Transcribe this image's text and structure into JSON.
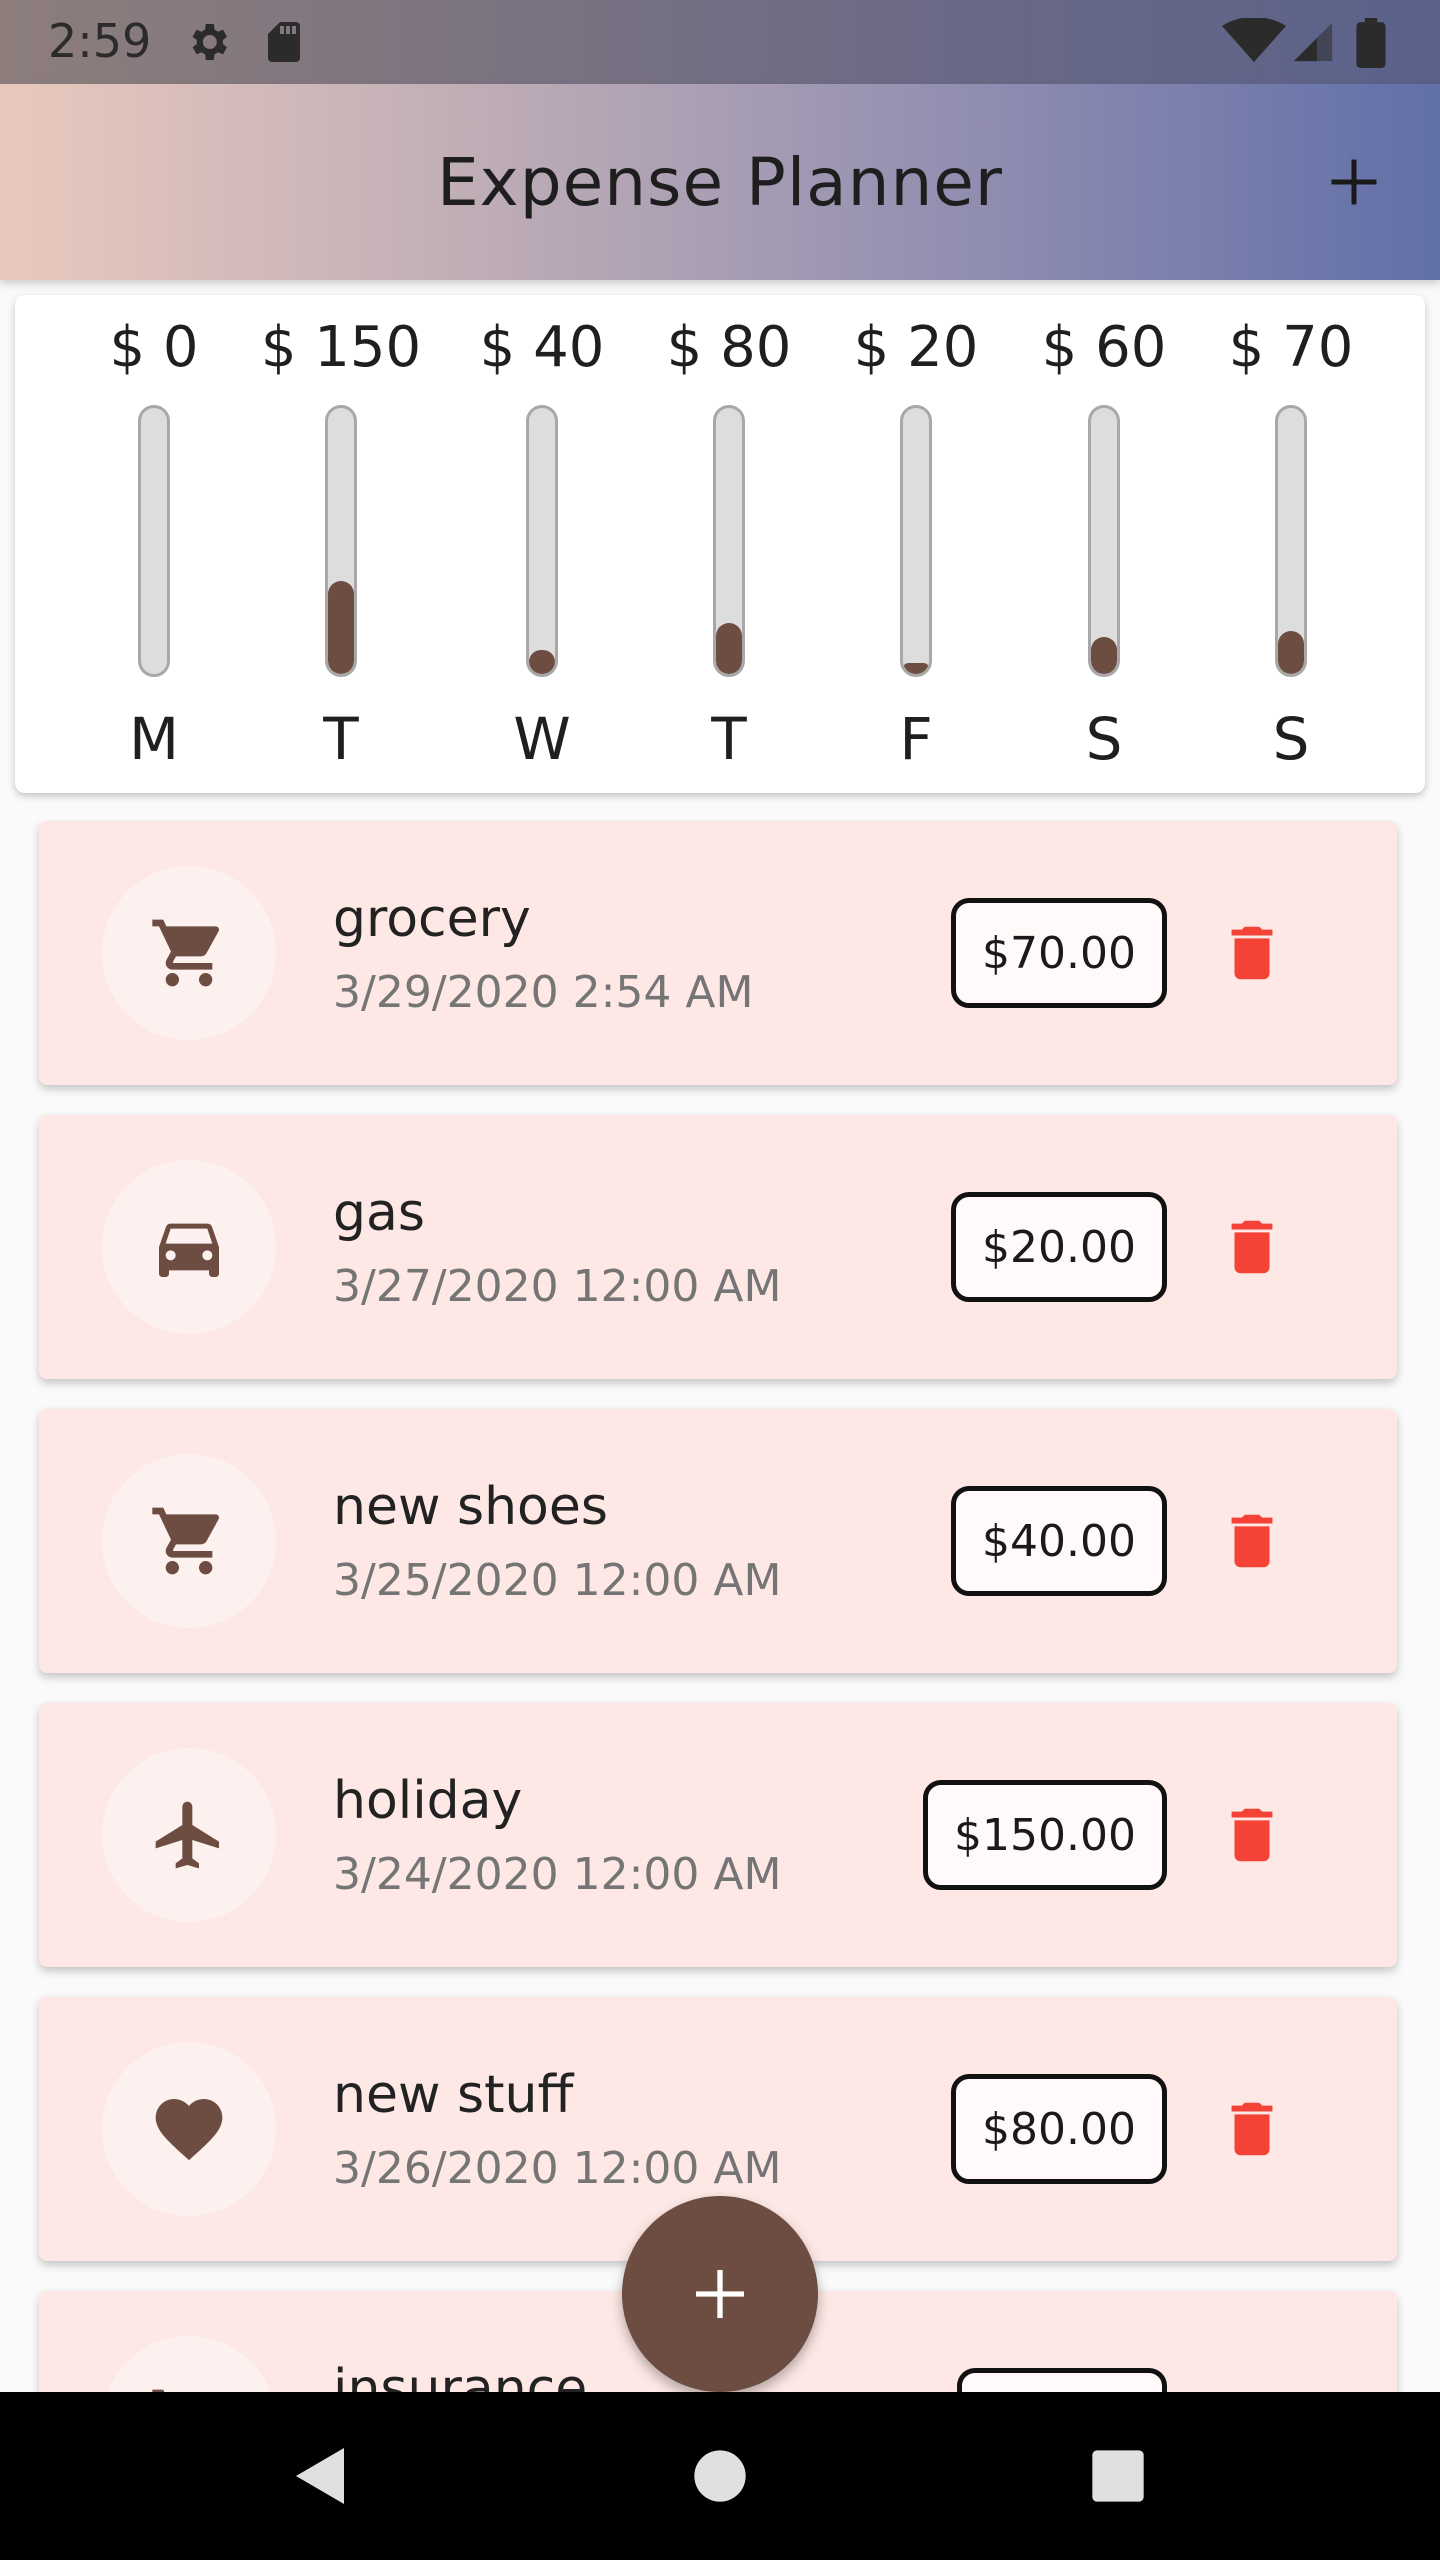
{
  "status_bar": {
    "time": "2:59",
    "icons": [
      "gear-icon",
      "sd-card-icon",
      "wifi-icon",
      "cell-signal-icon",
      "battery-icon"
    ]
  },
  "app_bar": {
    "title": "Expense Planner",
    "add_icon": "plus-icon"
  },
  "chart": {
    "accent_color": "#6d4c41",
    "days": [
      {
        "day": "M",
        "amount_label": "$ 0",
        "fraction": 0.0
      },
      {
        "day": "T",
        "amount_label": "$ 150",
        "fraction": 0.35
      },
      {
        "day": "W",
        "amount_label": "$ 40",
        "fraction": 0.09
      },
      {
        "day": "T",
        "amount_label": "$ 80",
        "fraction": 0.19
      },
      {
        "day": "F",
        "amount_label": "$ 20",
        "fraction": 0.04
      },
      {
        "day": "S",
        "amount_label": "$ 60",
        "fraction": 0.14
      },
      {
        "day": "S",
        "amount_label": "$ 70",
        "fraction": 0.16
      }
    ]
  },
  "transactions": [
    {
      "title": "grocery",
      "date": "3/29/2020 2:54 AM",
      "amount": "$70.00",
      "icon": "shopping-cart-icon"
    },
    {
      "title": "gas",
      "date": "3/27/2020 12:00 AM",
      "amount": "$20.00",
      "icon": "car-icon"
    },
    {
      "title": "new shoes",
      "date": "3/25/2020 12:00 AM",
      "amount": "$40.00",
      "icon": "shopping-cart-icon"
    },
    {
      "title": "holiday",
      "date": "3/24/2020 12:00 AM",
      "amount": "$150.00",
      "icon": "airplane-icon"
    },
    {
      "title": "new stuff",
      "date": "3/26/2020 12:00 AM",
      "amount": "$80.00",
      "icon": "heart-icon"
    },
    {
      "title": "insurance",
      "date": "",
      "amount": "",
      "icon": "shopping-cart-icon"
    }
  ],
  "colors": {
    "card_bg": "#fde8e5",
    "delete_red": "#f44336",
    "icon_brown": "#6d4c41"
  },
  "fab": {
    "icon": "plus-icon"
  },
  "nav_bar": {
    "buttons": [
      "back-icon",
      "home-icon",
      "recents-icon"
    ]
  }
}
